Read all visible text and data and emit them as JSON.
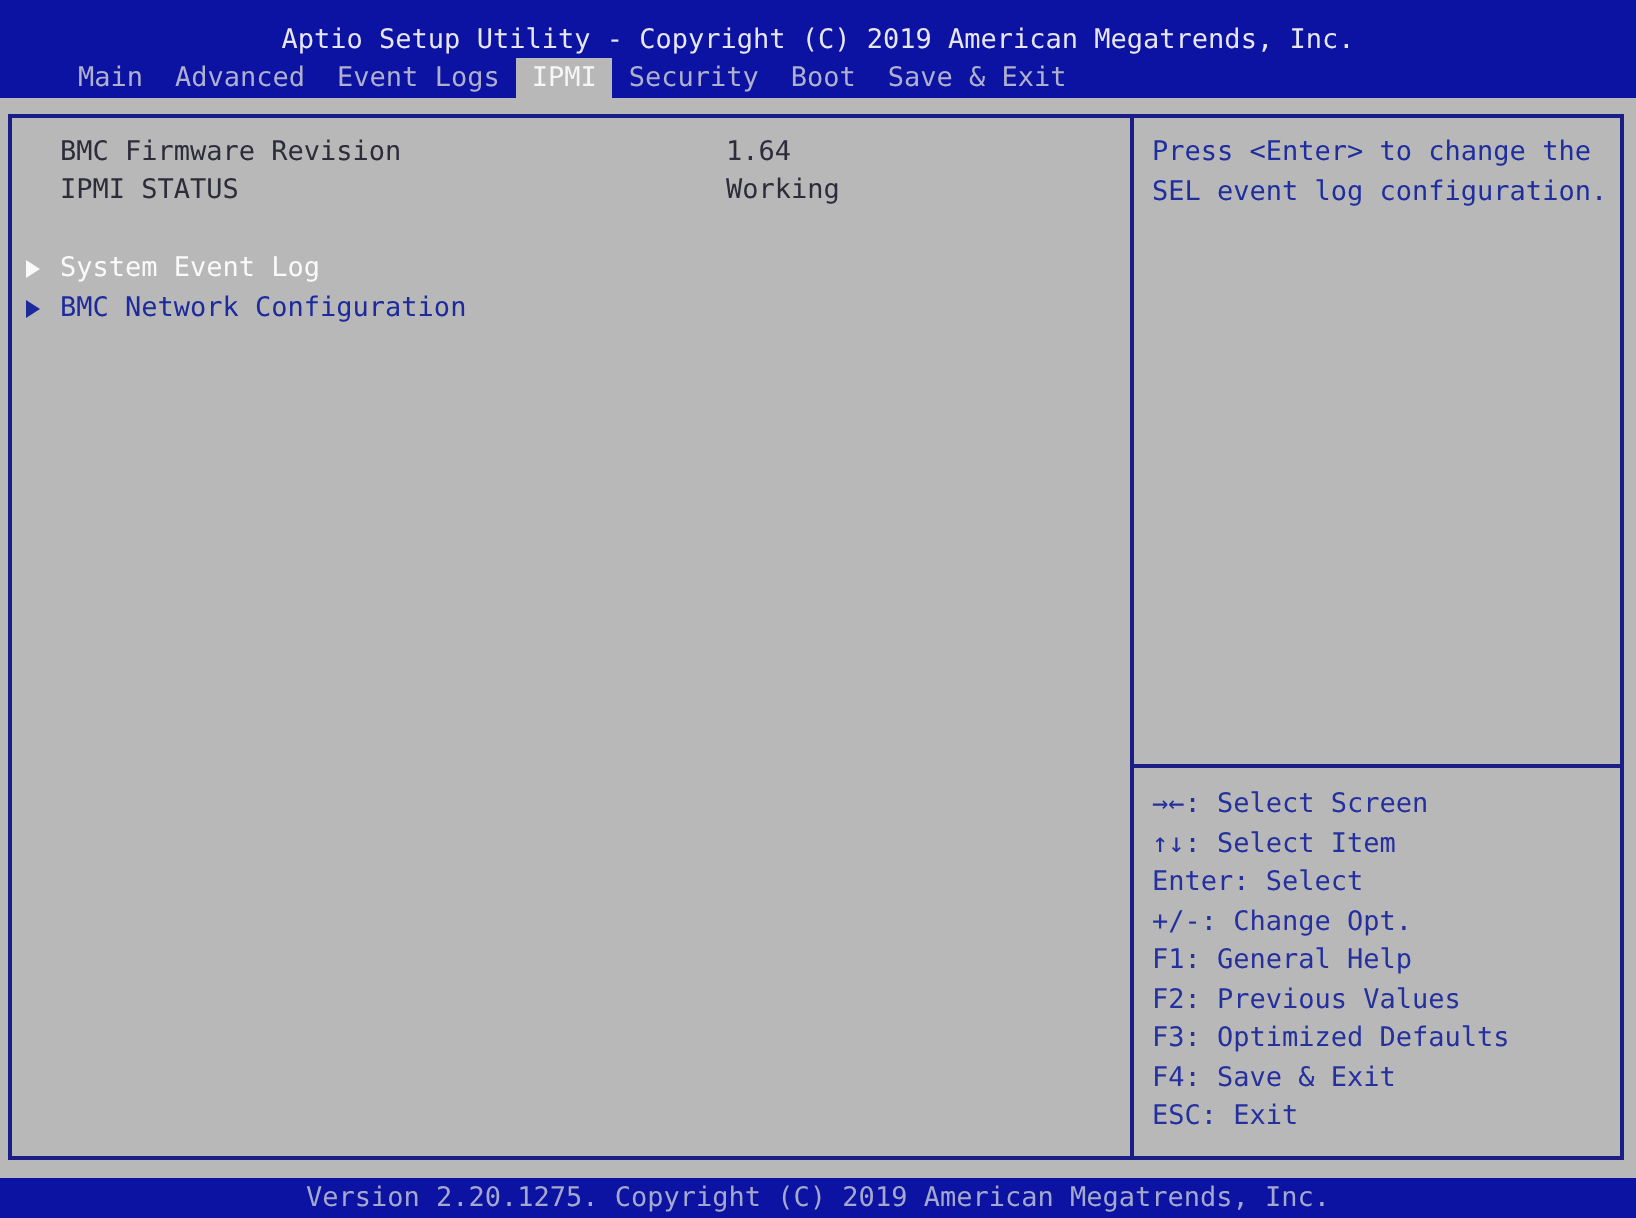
{
  "header": {
    "title": "Aptio Setup Utility - Copyright (C) 2019 American Megatrends, Inc."
  },
  "tabs": [
    {
      "label": "Main",
      "selected": false
    },
    {
      "label": "Advanced",
      "selected": false
    },
    {
      "label": "Event Logs",
      "selected": false
    },
    {
      "label": "IPMI",
      "selected": true
    },
    {
      "label": "Security",
      "selected": false
    },
    {
      "label": "Boot",
      "selected": false
    },
    {
      "label": "Save & Exit",
      "selected": false
    }
  ],
  "info_rows": [
    {
      "label": "BMC Firmware Revision",
      "value": "1.64"
    },
    {
      "label": "IPMI STATUS",
      "value": "Working"
    }
  ],
  "menu_items": [
    {
      "label": "System Event Log",
      "selected": true
    },
    {
      "label": "BMC Network Configuration",
      "selected": false
    }
  ],
  "help_text": "Press <Enter> to change the SEL event log configuration.",
  "key_help": [
    "→←: Select Screen",
    "↑↓: Select Item",
    "Enter: Select",
    "+/-: Change Opt.",
    "F1: General Help",
    "F2: Previous Values",
    "F3: Optimized Defaults",
    "F4: Save & Exit",
    "ESC: Exit"
  ],
  "footer": "Version 2.20.1275. Copyright (C) 2019 American Megatrends, Inc."
}
